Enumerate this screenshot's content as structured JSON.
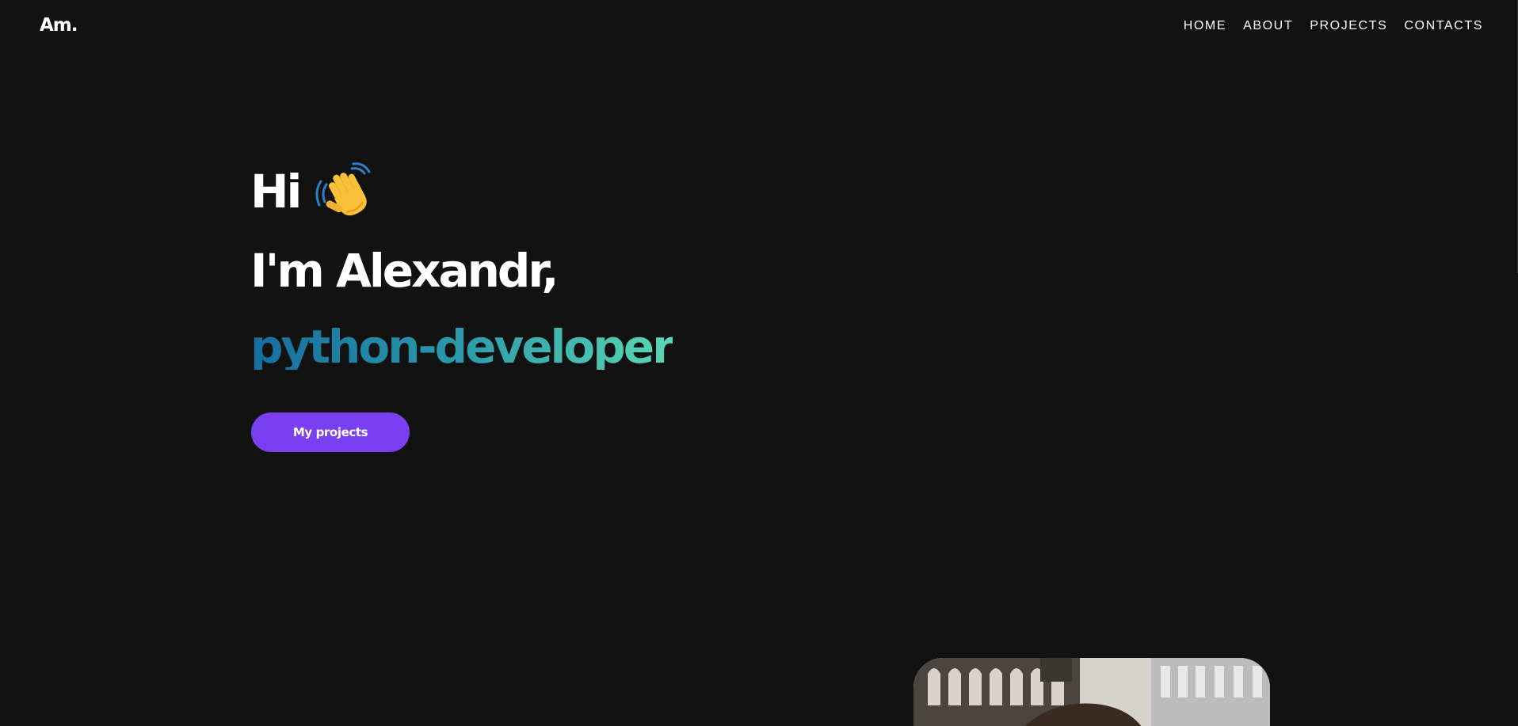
{
  "header": {
    "logo": "Am.",
    "nav": [
      {
        "label": "HOME"
      },
      {
        "label": "ABOUT"
      },
      {
        "label": "PROJECTS"
      },
      {
        "label": "CONTACTS"
      }
    ]
  },
  "hero": {
    "greeting": "Hi",
    "greeting_icon": "waving-hand-icon",
    "intro": "I'm Alexandr,",
    "role": "python-developer",
    "cta_label": "My projects"
  },
  "colors": {
    "background": "#121212",
    "text": "#ffffff",
    "accent": "#7a3ff0",
    "gradient_start": "#156e9f",
    "gradient_end": "#5ad7b4"
  }
}
